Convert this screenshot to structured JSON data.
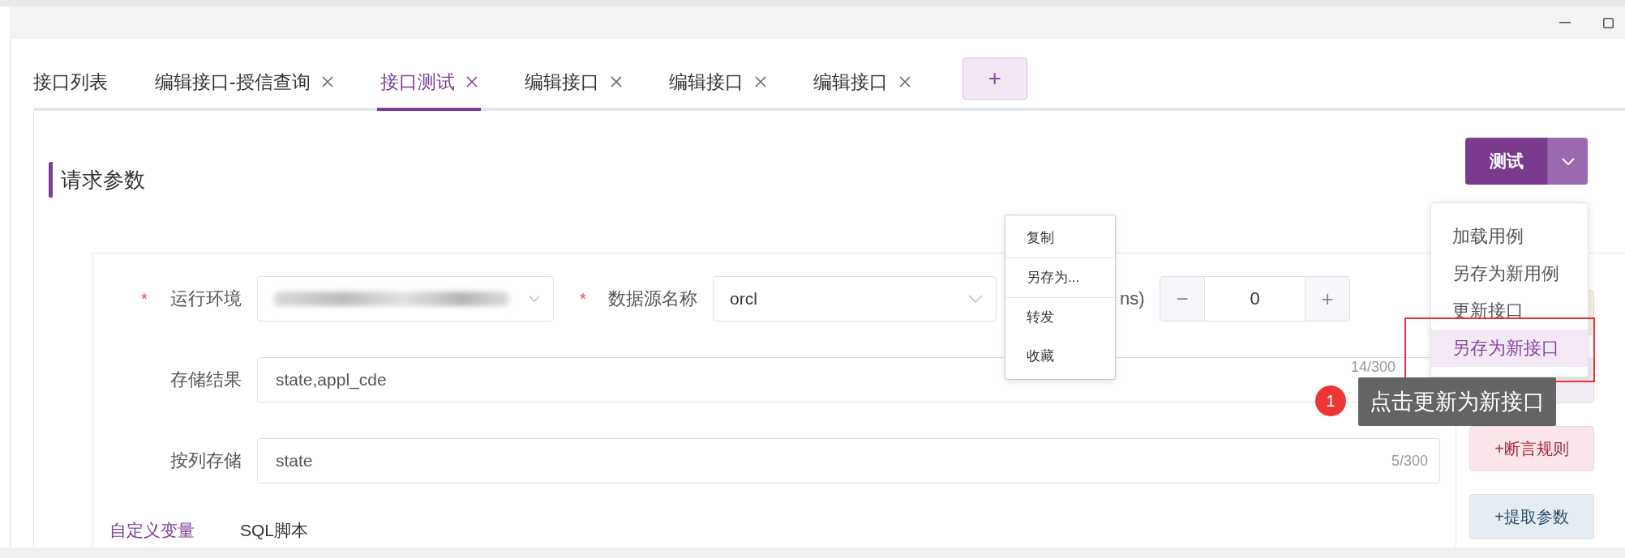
{
  "tabs": [
    {
      "label": "接口列表",
      "closable": false,
      "selected": false
    },
    {
      "label": "编辑接口-授信查询",
      "closable": true,
      "selected": false
    },
    {
      "label": "接口测试",
      "closable": true,
      "selected": true
    },
    {
      "label": "编辑接口",
      "closable": true,
      "selected": false
    },
    {
      "label": "编辑接口",
      "closable": true,
      "selected": false
    },
    {
      "label": "编辑接口",
      "closable": true,
      "selected": false
    }
  ],
  "add_tab": "+",
  "section_title": "请求参数",
  "test_button": "测试",
  "dropdown_menu": [
    {
      "label": "加载用例",
      "selected": false,
      "outlined": false
    },
    {
      "label": "另存为新用例",
      "selected": false,
      "outlined": false
    },
    {
      "label": "更新接口",
      "selected": false,
      "outlined": false
    },
    {
      "label": "另存为新接口",
      "selected": true,
      "outlined": true
    }
  ],
  "context_menu": [
    {
      "label": "复制",
      "separator_after": true
    },
    {
      "label": "另存为...",
      "separator_after": true
    },
    {
      "label": "转发",
      "separator_after": false
    },
    {
      "label": "收藏",
      "separator_after": false
    }
  ],
  "form": {
    "environment": {
      "mark": "*",
      "label": "运行环境",
      "redacted": true
    },
    "datasource": {
      "mark": "*",
      "label": "数据源名称",
      "value": "orcl"
    },
    "timeout_label": "ns)",
    "stepper": {
      "minus": "−",
      "value": "0",
      "plus": "+"
    },
    "store_result": {
      "label": "存储结果",
      "value": "state,appl_cde",
      "counter": "14/300"
    },
    "store_by_column": {
      "label": "按列存储",
      "value": "state",
      "counter": "5/300"
    }
  },
  "bottom_tabs": [
    {
      "label": "自定义变量",
      "selected": true
    },
    {
      "label": "SQL脚本",
      "selected": false
    }
  ],
  "side_buttons": [
    {
      "color": "#f7efe4"
    },
    {
      "color": "#f1ebf4"
    },
    {
      "label": "+断言规则",
      "color": "#f9e5ea",
      "kind": "assert"
    },
    {
      "label": "+提取参数",
      "color": "#e5edf2",
      "kind": "extract"
    }
  ],
  "tooltip": {
    "badge": "1",
    "text": "点击更新为新接口"
  }
}
